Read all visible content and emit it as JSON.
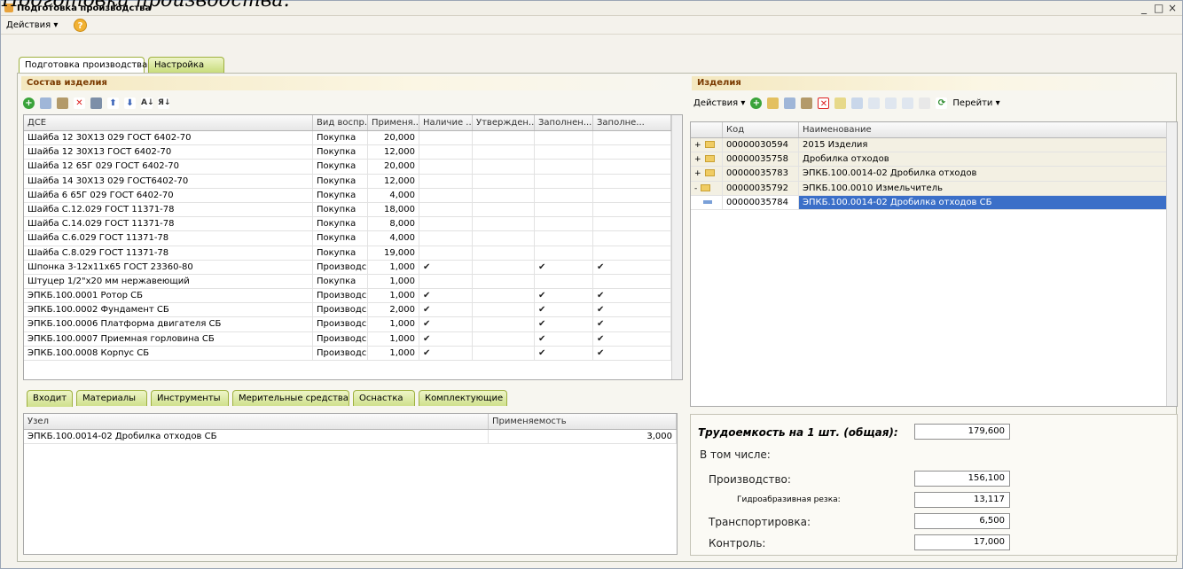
{
  "caption": "Подготовка производства.",
  "window": {
    "title": "Подготовка производства",
    "controls": [
      "_",
      "□",
      "×"
    ]
  },
  "menu": {
    "actions_label": "Действия ▾",
    "help_icon": "?"
  },
  "tabs": [
    {
      "label": "Подготовка производства"
    },
    {
      "label": "Настройка"
    }
  ],
  "composition": {
    "title": "Состав изделия",
    "toolbar_icons": [
      "add-icon",
      "copy-icon",
      "edit-icon",
      "delete-icon",
      "save-icon",
      "move-up-icon",
      "move-down-icon",
      "sort-asc-icon",
      "sort-desc-icon"
    ],
    "columns": [
      "ДСЕ",
      "Вид воспр...",
      "Применя...",
      "Наличие ...",
      "Утвержден...",
      "Заполнен...",
      "Заполне..."
    ],
    "rows": [
      [
        "Шайба 12 30Х13 029 ГОСТ 6402-70",
        "Покупка",
        "20,000",
        "",
        "",
        "",
        ""
      ],
      [
        "Шайба 12 30Х13 ГОСТ 6402-70",
        "Покупка",
        "12,000",
        "",
        "",
        "",
        ""
      ],
      [
        "Шайба 12 65Г 029 ГОСТ 6402-70",
        "Покупка",
        "20,000",
        "",
        "",
        "",
        ""
      ],
      [
        "Шайба 14 30Х13 029 ГОСТ6402-70",
        "Покупка",
        "12,000",
        "",
        "",
        "",
        ""
      ],
      [
        "Шайба 6 65Г 029 ГОСТ 6402-70",
        "Покупка",
        "4,000",
        "",
        "",
        "",
        ""
      ],
      [
        "Шайба С.12.029 ГОСТ 11371-78",
        "Покупка",
        "18,000",
        "",
        "",
        "",
        ""
      ],
      [
        "Шайба С.14.029 ГОСТ 11371-78",
        "Покупка",
        "8,000",
        "",
        "",
        "",
        ""
      ],
      [
        "Шайба С.6.029 ГОСТ 11371-78",
        "Покупка",
        "4,000",
        "",
        "",
        "",
        ""
      ],
      [
        "Шайба С.8.029 ГОСТ 11371-78",
        "Покупка",
        "19,000",
        "",
        "",
        "",
        ""
      ],
      [
        "Шпонка 3-12х11х65 ГОСТ 23360-80",
        "Производс...",
        "1,000",
        "✔",
        "",
        "✔",
        "✔"
      ],
      [
        "Штуцер 1/2\"х20 мм нержавеющий",
        "Покупка",
        "1,000",
        "",
        "",
        "",
        ""
      ],
      [
        "ЭПКБ.100.0001 Ротор СБ",
        "Производс...",
        "1,000",
        "✔",
        "",
        "✔",
        "✔"
      ],
      [
        "ЭПКБ.100.0002 Фундамент СБ",
        "Производс...",
        "2,000",
        "✔",
        "",
        "✔",
        "✔"
      ],
      [
        "ЭПКБ.100.0006 Платформа двигателя СБ",
        "Производс...",
        "1,000",
        "✔",
        "",
        "✔",
        "✔"
      ],
      [
        "ЭПКБ.100.0007 Приемная горловина СБ",
        "Производс...",
        "1,000",
        "✔",
        "",
        "✔",
        "✔"
      ],
      [
        "ЭПКБ.100.0008 Корпус СБ",
        "Производс...",
        "1,000",
        "✔",
        "",
        "✔",
        "✔"
      ]
    ]
  },
  "subtabs": [
    {
      "label": "Входит"
    },
    {
      "label": "Материалы"
    },
    {
      "label": "Инструменты"
    },
    {
      "label": "Мерительные средства"
    },
    {
      "label": "Оснастка"
    },
    {
      "label": "Комплектующие"
    }
  ],
  "includes": {
    "columns": [
      "Узел",
      "Применяемость"
    ],
    "rows": [
      [
        "ЭПКБ.100.0014-02 Дробилка отходов СБ",
        "3,000"
      ]
    ]
  },
  "products": {
    "title": "Изделия",
    "actions_label": "Действия ▾",
    "goto_label": "Перейти ▾",
    "columns": [
      "Код",
      "Наименование"
    ],
    "rows": [
      {
        "code": "00000030594",
        "name": "2015 Изделия",
        "expander": "+",
        "kind": "folder"
      },
      {
        "code": "00000035758",
        "name": "Дробилка отходов",
        "expander": "+",
        "kind": "folder"
      },
      {
        "code": "00000035783",
        "name": "ЭПКБ.100.0014-02 Дробилка отходов",
        "expander": "+",
        "kind": "folder"
      },
      {
        "code": "00000035792",
        "name": "ЭПКБ.100.0010 Измельчитель",
        "expander": "-",
        "kind": "folder"
      },
      {
        "code": "00000035784",
        "name": "ЭПКБ.100.0014-02 Дробилка отходов СБ",
        "expander": "",
        "kind": "item"
      }
    ]
  },
  "labor": {
    "total_label": "Трудоемкость на 1 шт. (общая):",
    "total_value": "179,600",
    "including_label": "В том числе:",
    "production_label": "Производство:",
    "production_value": "156,100",
    "waterjet_label": "Гидроабразивная резка:",
    "waterjet_value": "13,117",
    "transport_label": "Транспортировка:",
    "transport_value": "6,500",
    "control_label": "Контроль:",
    "control_value": "17,000"
  },
  "colors": {
    "accent": "#3b6fc8",
    "section_title": "#7a3a00",
    "tab_green": "#c8dc7c"
  }
}
